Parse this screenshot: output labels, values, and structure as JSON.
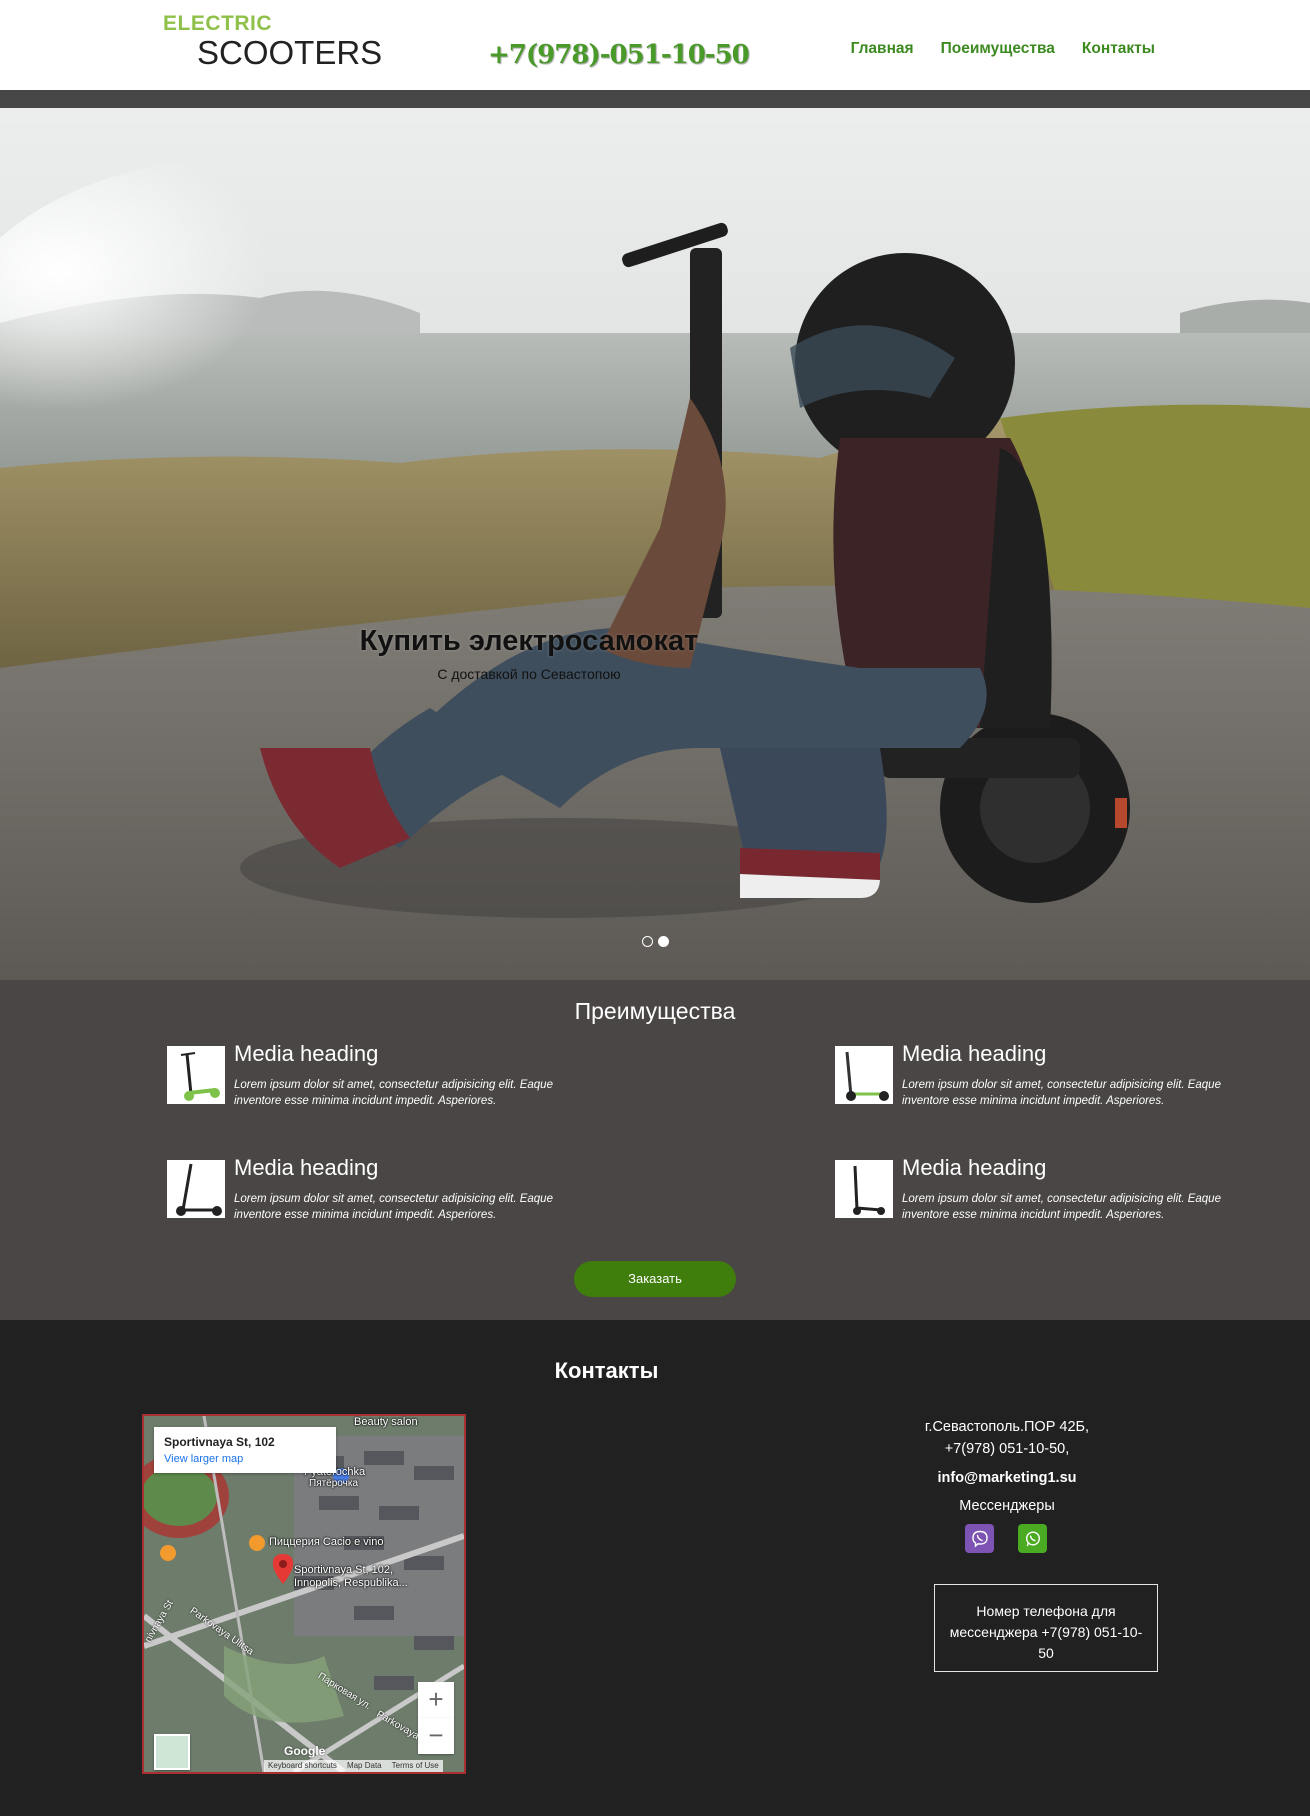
{
  "header": {
    "logo_top": "ELECTRIC",
    "logo_bottom": "SCOOTERS",
    "phone": "+7(978)-051-10-50",
    "nav": [
      "Главная",
      "Поеимущества",
      "Контакты"
    ]
  },
  "hero": {
    "title": "Купить электросамокат",
    "subtitle": "С доставкой по Севастопою",
    "slides_count": 2,
    "active_slide": 2
  },
  "advantages": {
    "title": "Преимущества",
    "items": [
      {
        "heading": "Media heading",
        "text": "Lorem ipsum dolor sit amet, consectetur adipisicing elit. Eaque inventore esse minima incidunt impedit. Asperiores."
      },
      {
        "heading": "Media heading",
        "text": "Lorem ipsum dolor sit amet, consectetur adipisicing elit. Eaque inventore esse minima incidunt impedit. Asperiores."
      },
      {
        "heading": "Media heading",
        "text": "Lorem ipsum dolor sit amet, consectetur adipisicing elit. Eaque inventore esse minima incidunt impedit. Asperiores."
      },
      {
        "heading": "Media heading",
        "text": "Lorem ipsum dolor sit amet, consectetur adipisicing elit. Eaque inventore esse minima incidunt impedit. Asperiores."
      }
    ],
    "button": "Заказать"
  },
  "contacts": {
    "title": "Контакты",
    "address": "г.Севастополь.ПОР 42Б,",
    "phone": "+7(978) 051-10-50,",
    "email": "info@marketing1.su",
    "messengers_label": "Мессенджеры",
    "messenger_box": "Номер телефона для мессенджера +7(978) 051-10-50",
    "map": {
      "card_address": "Sportivnaya St, 102",
      "card_link": "View larger map",
      "labels": [
        "Beauty salon",
        "Pyaterochka",
        "Пятёрочка",
        "Пиццерия Cacio e vino",
        "Sportivnaya St, 102,",
        "Innopolis, Respublika...",
        "Parkovaya Ulitsa",
        "Парковая ул.",
        "nivnaya St",
        "Parkovaya"
      ],
      "zoom_in": "+",
      "zoom_out": "−",
      "google": "Google",
      "footer": [
        "Keyboard shortcuts",
        "Map Data",
        "Terms of Use"
      ]
    }
  },
  "colors": {
    "accent_green": "#3d8a21",
    "button_green": "#3f7d0d",
    "adv_bg": "#4a4645",
    "footer_bg": "#212121",
    "viber": "#7d53b3",
    "whatsapp": "#4aaa22"
  },
  "icons": [
    "scooter-logo-icon",
    "viber-icon",
    "whatsapp-icon",
    "map-pin-icon"
  ]
}
